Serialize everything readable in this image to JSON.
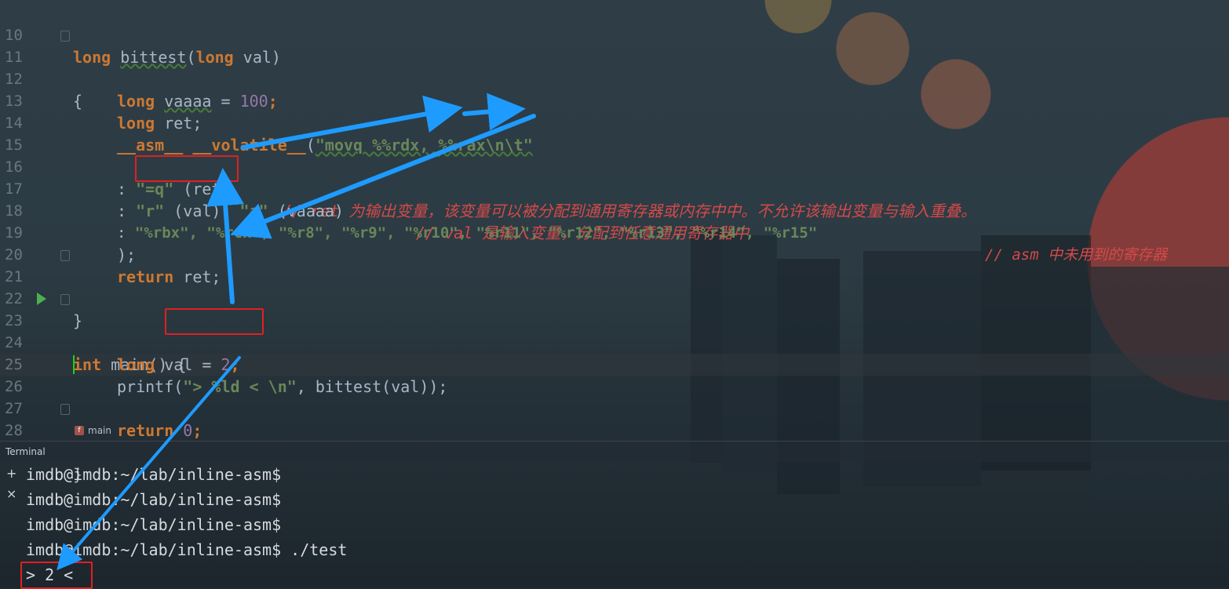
{
  "editor": {
    "lines": [
      {
        "n": "10"
      },
      {
        "n": "11"
      },
      {
        "n": "12"
      },
      {
        "n": "13"
      },
      {
        "n": "14"
      },
      {
        "n": "15"
      },
      {
        "n": "16"
      },
      {
        "n": "17"
      },
      {
        "n": "18"
      },
      {
        "n": "19"
      },
      {
        "n": "20"
      },
      {
        "n": "21"
      },
      {
        "n": "22"
      },
      {
        "n": "23"
      },
      {
        "n": "24"
      },
      {
        "n": "25"
      },
      {
        "n": "26"
      },
      {
        "n": "27"
      },
      {
        "n": "28"
      }
    ],
    "code": {
      "l10_kw1": "long",
      "l10_fn": "bittest",
      "l10_p": "(",
      "l10_kw2": "long",
      "l10_rest": " val)",
      "l11": "{",
      "l12_kw": "long",
      "l12_id": "vaaaa",
      "l12_eq": " = ",
      "l12_num": "100",
      "l12_end": ";",
      "l13_kw": "long",
      "l13_rest": " ret;",
      "l14_kw1": "__asm__",
      "l14_kw2": "__volatile__",
      "l14_p": "(",
      "l14_str": "\"movq %%rdx, %%rax\\n\\t\"",
      "l16_c": ": ",
      "l16_str": "\"=q\"",
      "l16_rest": " (ret)",
      "l16_cmt": "// ret 为输出变量，该变量可以被分配到通用寄存器或内存中中。不允许该输出变量与输入重叠。",
      "l17_c": ": ",
      "l17_str1": "\"r\"",
      "l17_mid": " (val), ",
      "l17_str2": "\"a\"",
      "l17_rest": " (vaaaa)",
      "l17_cmt": "// val 是输入变量，分配到任意通用寄存器中",
      "l18_c": ": ",
      "l18_str": "\"%rbx\", \"%rcx\", \"%r8\", \"%r9\", \"%r10\", \"%r11\", \"%r12\", \"%r13\", \"%r14\", \"%r15\"",
      "l18_cmt": "// asm 中未用到的寄存器",
      "l19": ");",
      "l20_kw": "return",
      "l20_rest": " ret;",
      "l21": "}",
      "l23_kw": "int",
      "l23_rest": " main() {",
      "l24_kw": "long",
      "l24_id": " val = ",
      "l24_num": "2",
      "l24_end": ";",
      "l25_fn": "printf(",
      "l25_str": "\"> %ld < \\n\"",
      "l25_rest": ", bittest(val));",
      "l27_kw": "return",
      "l27_num": "0",
      "l27_end": ";",
      "l28": "}"
    }
  },
  "breadcrumb": {
    "badge": "f",
    "label": "main"
  },
  "terminal": {
    "title": "Terminal",
    "add": "+",
    "close": "×",
    "lines": [
      "imdb@imdb:~/lab/inline-asm$",
      "imdb@imdb:~/lab/inline-asm$",
      "imdb@imdb:~/lab/inline-asm$",
      "imdb@imdb:~/lab/inline-asm$ ./test",
      "> 2 <"
    ]
  },
  "colors": {
    "annotation_box": "#e02020",
    "annotation_arrow": "#1e9bff"
  }
}
